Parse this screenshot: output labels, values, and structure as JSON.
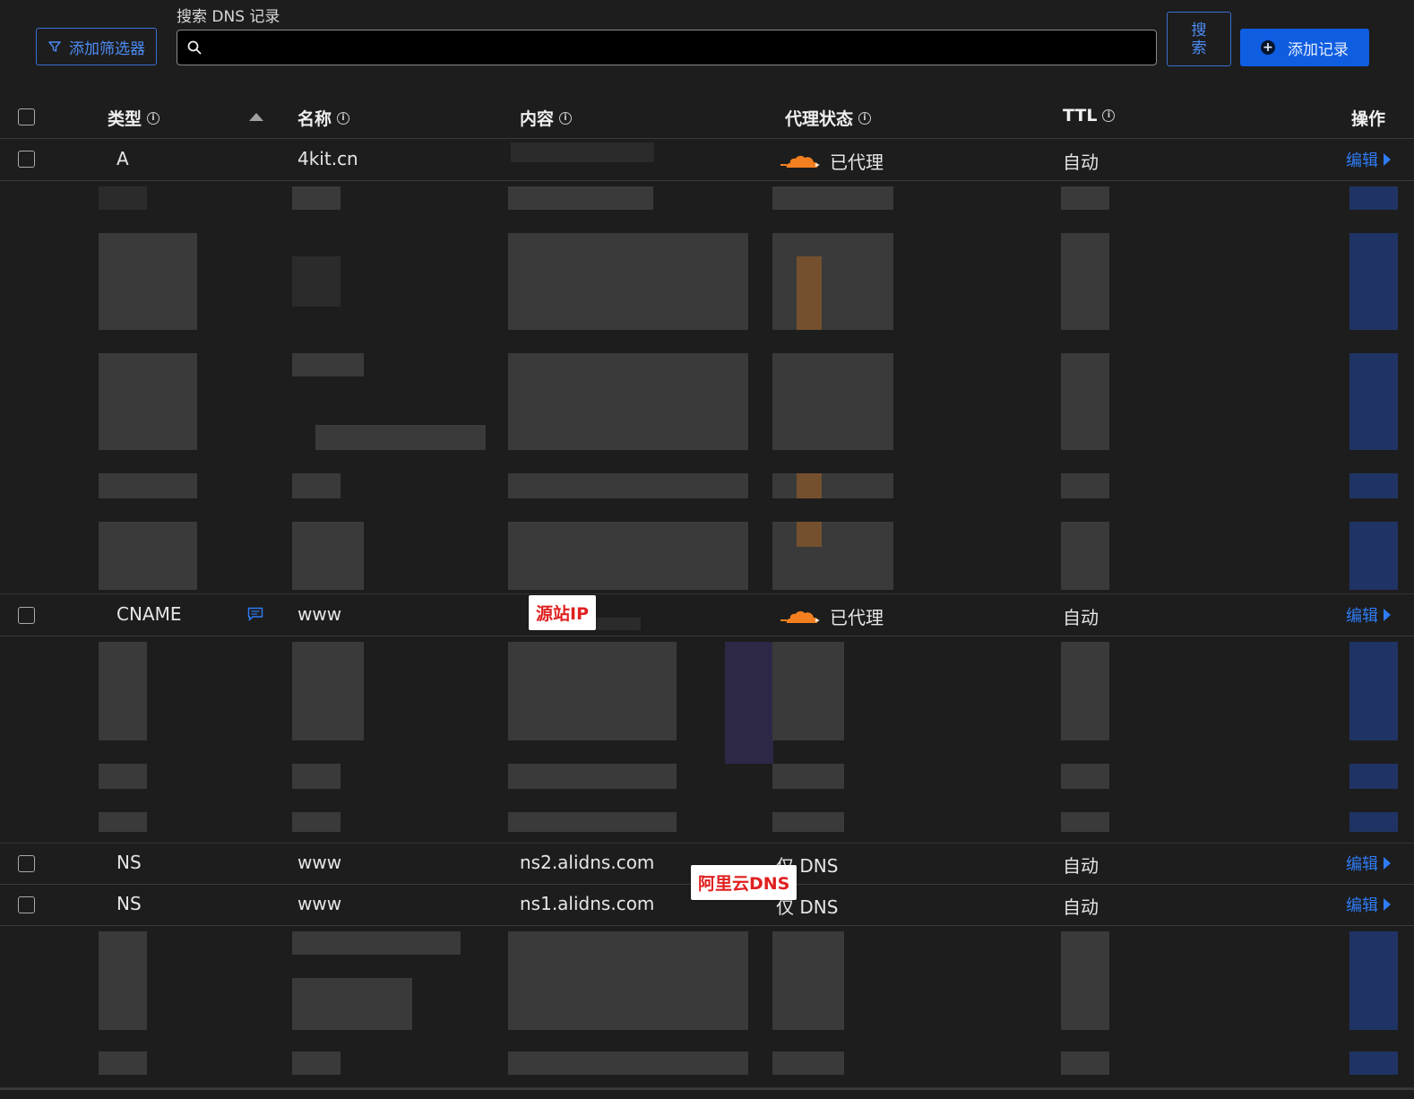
{
  "toolbar": {
    "search_label": "搜索 DNS 记录",
    "filter_button": "添加筛选器",
    "search_placeholder": "",
    "search_button": "搜索",
    "add_button": "添加记录"
  },
  "table": {
    "headers": {
      "type": "类型",
      "name": "名称",
      "content": "内容",
      "proxy": "代理状态",
      "ttl": "TTL",
      "actions": "操作"
    },
    "rows": [
      {
        "type": "A",
        "name": "4kit.cn",
        "content": "",
        "proxy": "已代理",
        "ttl": "自动",
        "action": "编辑"
      },
      {
        "type": "CNAME",
        "name": "www",
        "content": "",
        "proxy": "已代理",
        "ttl": "自动",
        "action": "编辑"
      },
      {
        "type": "NS",
        "name": "www",
        "content": "ns2.alidns.com",
        "proxy": "仅 DNS",
        "ttl": "自动",
        "action": "编辑"
      },
      {
        "type": "NS",
        "name": "www",
        "content": "ns1.alidns.com",
        "proxy": "仅 DNS",
        "ttl": "自动",
        "action": "编辑"
      }
    ]
  },
  "annotations": {
    "origin_ip": "源站IP",
    "aliyun_dns": "阿里云DNS"
  },
  "colors": {
    "background": "#1d1d1d",
    "accent": "#0f5de0",
    "link": "#2f7cf6",
    "proxy_cloud": "#f38020"
  }
}
